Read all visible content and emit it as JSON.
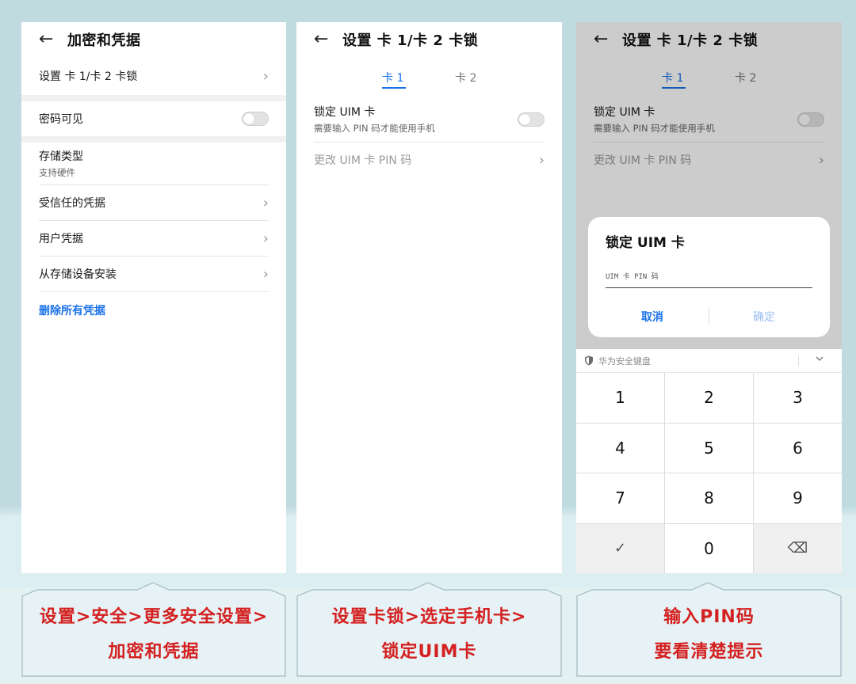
{
  "screen1": {
    "title": "加密和凭据",
    "items": [
      {
        "label": "设置 卡 1/卡 2 卡锁"
      },
      {
        "label": "密码可见"
      },
      {
        "label": "存储类型",
        "sub": "支持硬件"
      },
      {
        "label": "受信任的凭据"
      },
      {
        "label": "用户凭据"
      },
      {
        "label": "从存储设备安装"
      }
    ],
    "delete_link": "删除所有凭据"
  },
  "screen2": {
    "title": "设置 卡 1/卡 2 卡锁",
    "tabs": [
      "卡 1",
      "卡 2"
    ],
    "lock_label": "锁定 UIM 卡",
    "lock_sub": "需要输入 PIN 码才能使用手机",
    "change_pin": "更改 UIM 卡 PIN 码"
  },
  "screen3": {
    "title": "设置 卡 1/卡 2 卡锁",
    "tabs": [
      "卡 1",
      "卡 2"
    ],
    "lock_label": "锁定 UIM 卡",
    "lock_sub": "需要输入 PIN 码才能使用手机",
    "change_pin": "更改 UIM 卡 PIN 码",
    "dialog": {
      "title": "锁定 UIM 卡",
      "placeholder": "UIM 卡 PIN 码",
      "cancel": "取消",
      "ok": "确定"
    },
    "keyboard": {
      "name": "华为安全键盘",
      "keys": [
        "1",
        "2",
        "3",
        "4",
        "5",
        "6",
        "7",
        "8",
        "9",
        "✓",
        "0",
        "⌫"
      ]
    }
  },
  "captions": {
    "c1": [
      "设置>安全>更多安全设置>",
      "加密和凭据"
    ],
    "c2": [
      "设置卡锁>选定手机卡>",
      "锁定UIM卡"
    ],
    "c3": [
      "输入PIN码",
      "要看清楚提示"
    ]
  },
  "colors": {
    "accent": "#1a72e8",
    "caption_red": "#d42020",
    "background": "#bfdbe0"
  },
  "icons": [
    "back-arrow-icon",
    "chevron-right-icon",
    "toggle-switch",
    "shield-icon",
    "chevron-down-icon",
    "check-icon",
    "backspace-icon"
  ]
}
